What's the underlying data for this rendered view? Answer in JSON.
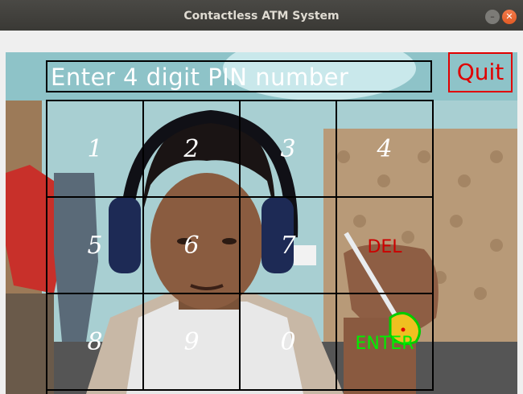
{
  "window": {
    "title": "Contactless ATM System",
    "controls": {
      "minimize_icon": "minimize-icon",
      "close_icon": "close-icon"
    }
  },
  "pin_display": {
    "text": "Enter 4 digit PIN number"
  },
  "quit": {
    "label": "Quit",
    "color": "#e00000"
  },
  "keypad": {
    "keys": [
      {
        "label": "1",
        "kind": "digit"
      },
      {
        "label": "2",
        "kind": "digit"
      },
      {
        "label": "3",
        "kind": "digit"
      },
      {
        "label": "4",
        "kind": "digit"
      },
      {
        "label": "5",
        "kind": "digit"
      },
      {
        "label": "6",
        "kind": "digit"
      },
      {
        "label": "7",
        "kind": "digit"
      },
      {
        "label": "DEL",
        "kind": "delete"
      },
      {
        "label": "8",
        "kind": "digit"
      },
      {
        "label": "9",
        "kind": "digit"
      },
      {
        "label": "0",
        "kind": "digit"
      },
      {
        "label": "ENTER",
        "kind": "enter"
      }
    ],
    "colors": {
      "digit": "#ffffff",
      "delete": "#cc0000",
      "enter": "#00ee00",
      "grid": "#000000"
    }
  },
  "camera": {
    "tracked_marker_color": "#f0c020",
    "tracked_outline_color": "#00cc00"
  }
}
